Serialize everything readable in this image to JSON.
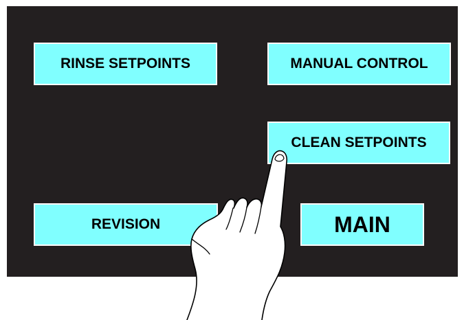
{
  "buttons": {
    "rinse_setpoints": "RINSE SETPOINTS",
    "manual_control": "MANUAL CONTROL",
    "clean_setpoints": "CLEAN SETPOINTS",
    "revision": "REVISION",
    "main": "MAIN"
  },
  "colors": {
    "panel_background": "#231f20",
    "button_fill": "#80ffff",
    "button_border": "#ffffff",
    "button_text": "#000000"
  },
  "icons": {
    "pointer": "pointing-hand-icon"
  }
}
